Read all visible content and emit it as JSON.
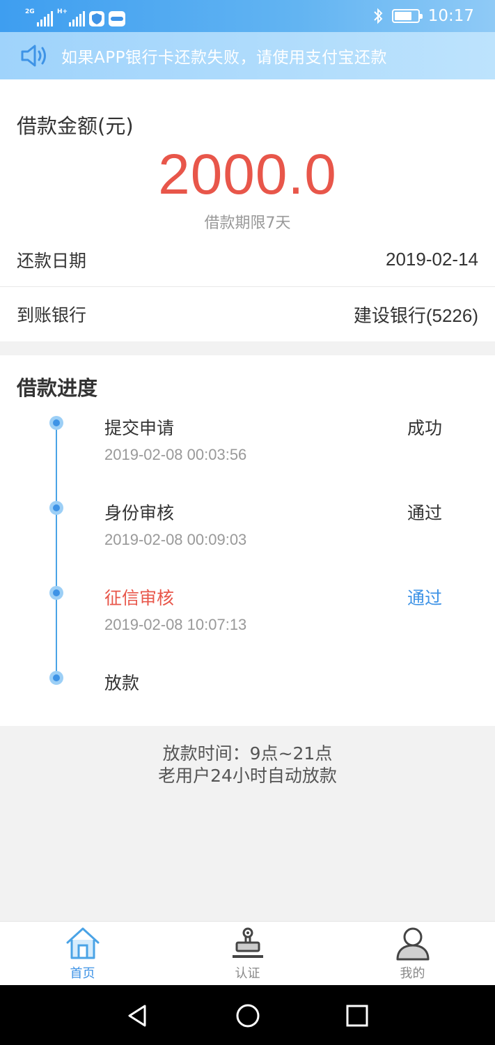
{
  "status_bar": {
    "signal1_tag": "2G",
    "signal2_tag": "H+",
    "time": "10:17"
  },
  "notice": {
    "text": "如果APP银行卡还款失败，请使用支付宝还款",
    "icon": "speaker-icon"
  },
  "loan": {
    "amount_label": "借款金额(元)",
    "amount": "2000.0",
    "term": "借款期限7天",
    "repay_date_label": "还款日期",
    "repay_date": "2019-02-14",
    "bank_label": "到账银行",
    "bank": "建设银行(5226)"
  },
  "progress": {
    "title": "借款进度",
    "steps": [
      {
        "name": "提交申请",
        "time": "2019-02-08 00:03:56",
        "status": "成功"
      },
      {
        "name": "身份审核",
        "time": "2019-02-08 00:09:03",
        "status": "通过"
      },
      {
        "name": "征信审核",
        "time": "2019-02-08 10:07:13",
        "status": "通过"
      },
      {
        "name": "放款",
        "time": "",
        "status": ""
      }
    ]
  },
  "info": {
    "line1": "放款时间：9点~21点",
    "line2": "老用户24小时自动放款"
  },
  "bottom_nav": {
    "items": [
      {
        "label": "首页",
        "icon": "home-icon",
        "active": true
      },
      {
        "label": "认证",
        "icon": "stamp-icon",
        "active": false
      },
      {
        "label": "我的",
        "icon": "user-icon",
        "active": false
      }
    ]
  },
  "colors": {
    "accent_blue": "#3e93e6",
    "amount_red": "#e8564a",
    "status_bar": "#3e9ef0"
  }
}
